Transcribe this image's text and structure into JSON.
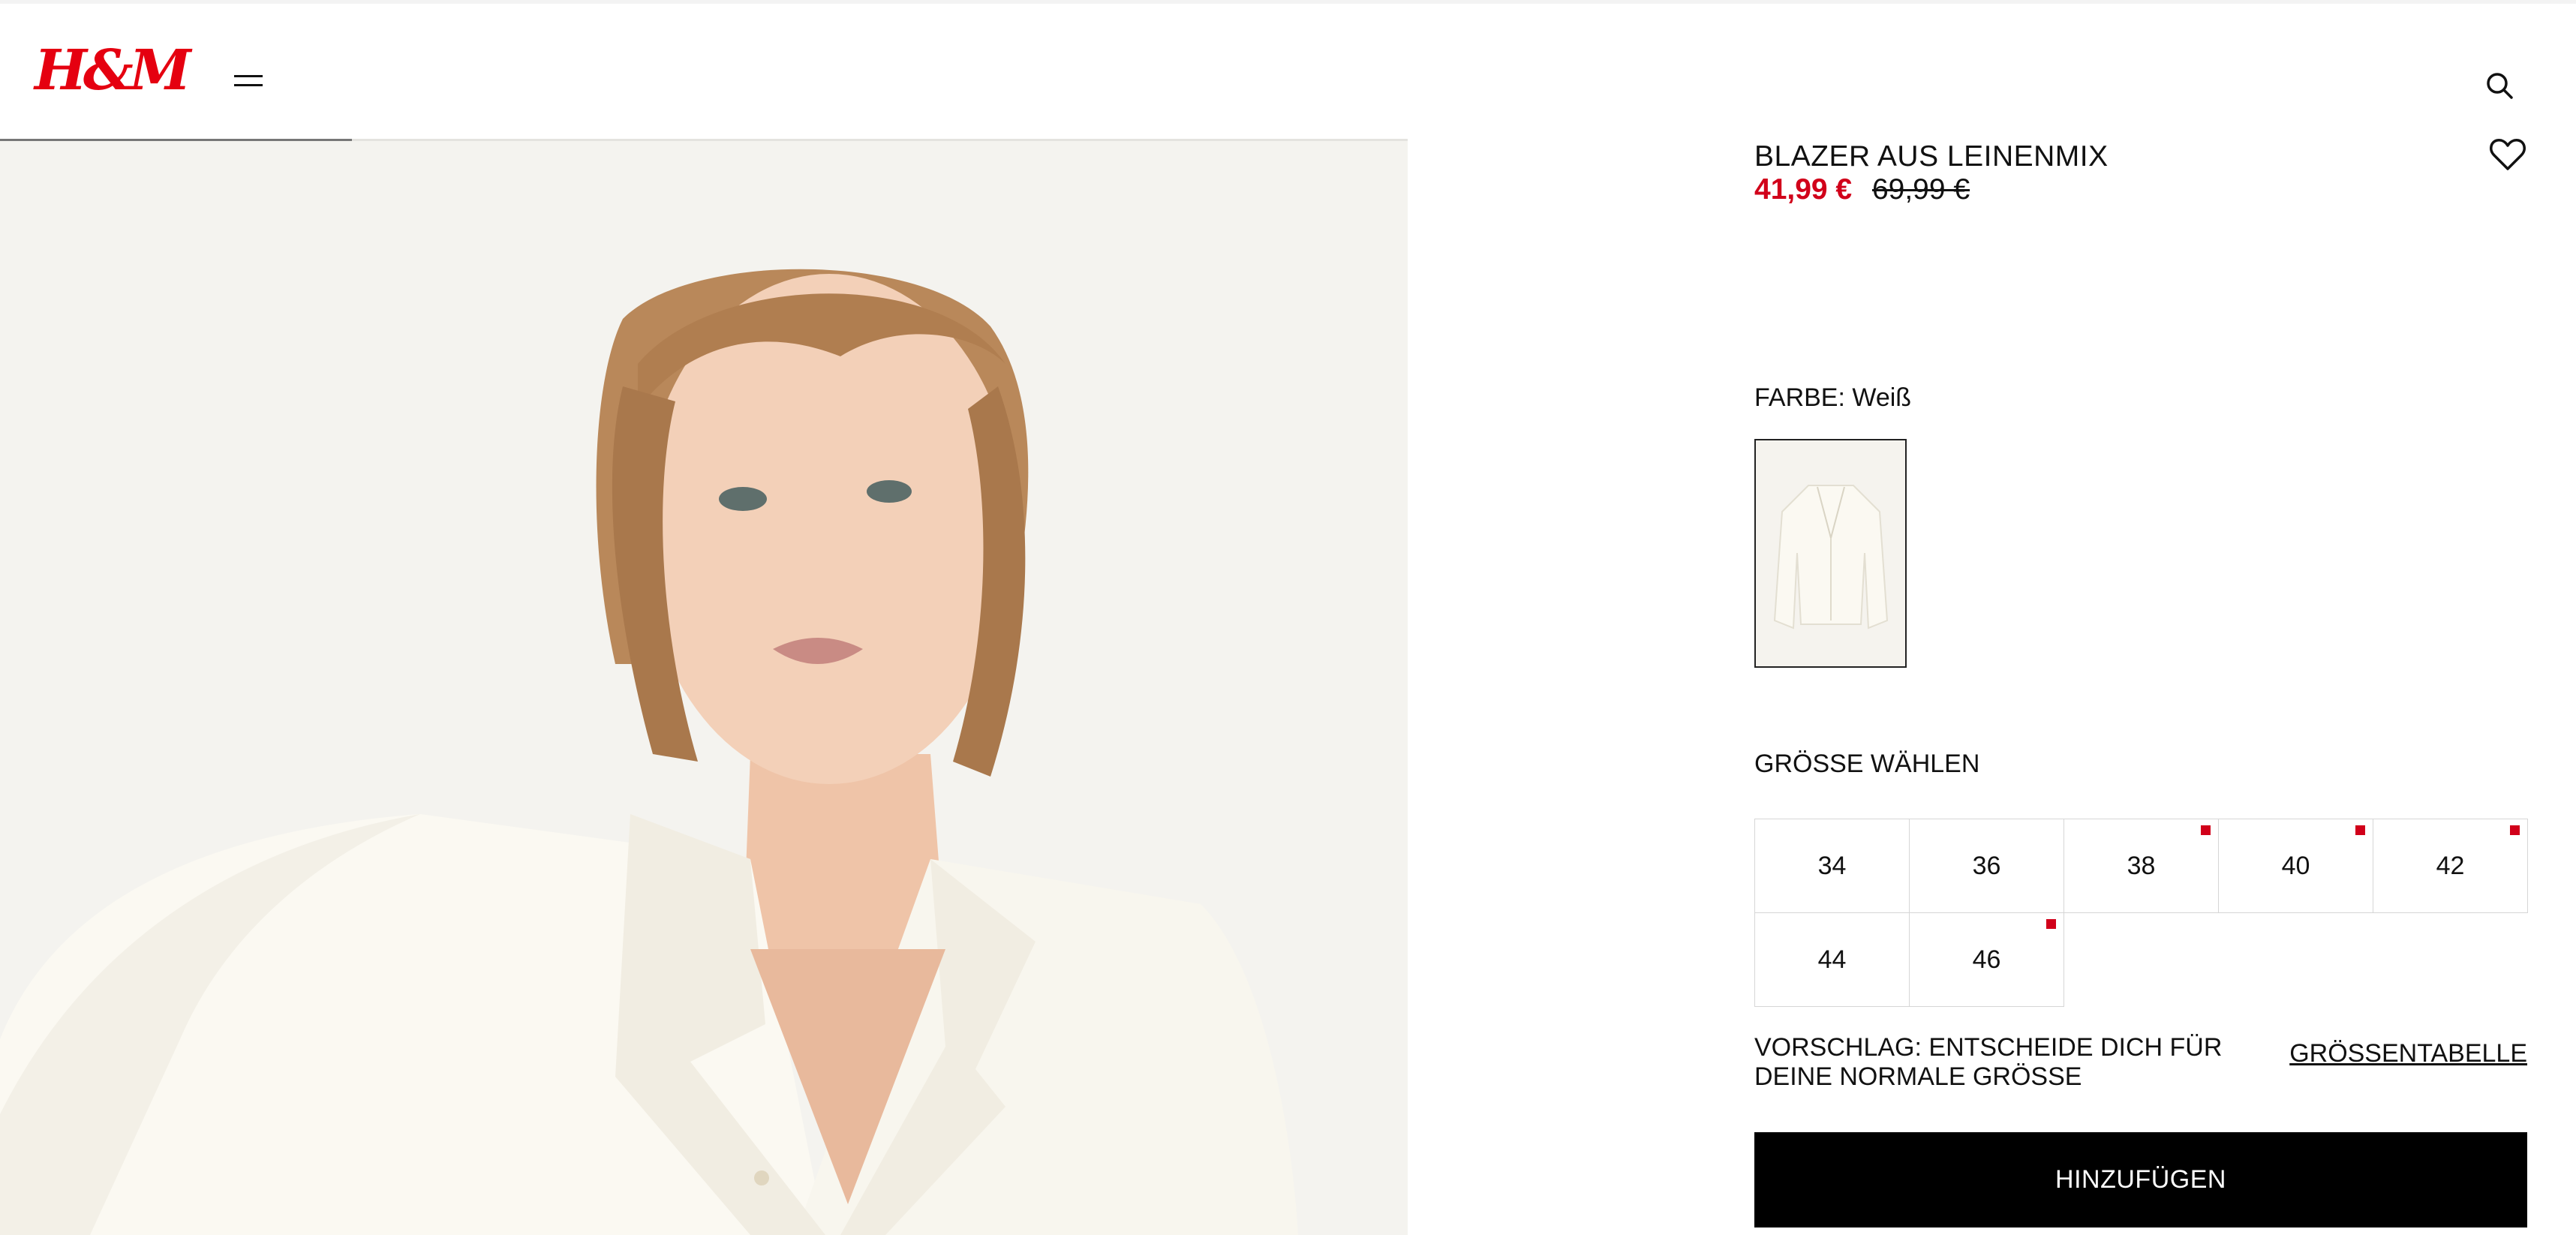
{
  "header": {
    "logo_text": "H&M",
    "brand_color": "#e50010",
    "menu_icon": "hamburger-menu-icon",
    "search_icon": "search-icon"
  },
  "gallery": {
    "progress_fraction": 0.25,
    "image_description_icon": "product-photo"
  },
  "product": {
    "title": "BLAZER AUS LEINENMIX",
    "price_sale": "41,99 €",
    "price_original": "69,99 €",
    "sale_color": "#d1001a",
    "wishlist_icon": "heart-outline-icon"
  },
  "color": {
    "label": "FARBE: Weiß"
  },
  "size": {
    "label": "GRÖSSE WÄHLEN",
    "options": [
      {
        "value": "34",
        "low_stock": false
      },
      {
        "value": "36",
        "low_stock": false
      },
      {
        "value": "38",
        "low_stock": true
      },
      {
        "value": "40",
        "low_stock": true
      },
      {
        "value": "42",
        "low_stock": true
      },
      {
        "value": "44",
        "low_stock": false
      },
      {
        "value": "46",
        "low_stock": true
      }
    ],
    "suggestion": "VORSCHLAG: ENTSCHEIDE DICH FÜR DEINE NORMALE GRÖSSE",
    "size_chart_link": "GRÖSSENTABELLE"
  },
  "cart": {
    "add_button": "HINZUFÜGEN"
  }
}
